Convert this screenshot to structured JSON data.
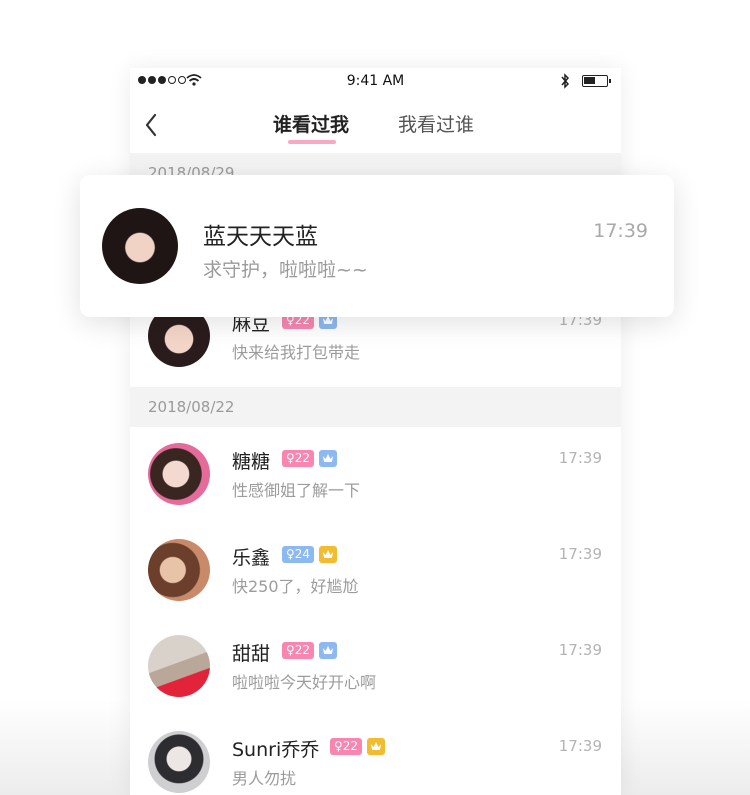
{
  "status_bar": {
    "time": "9:41 AM"
  },
  "nav": {
    "tabs": [
      {
        "label": "谁看过我",
        "active": true
      },
      {
        "label": "我看过谁",
        "active": false
      }
    ]
  },
  "sections": [
    {
      "date": "2018/08/29"
    },
    {
      "date": "2018/08/22"
    }
  ],
  "popup": {
    "name": "蓝天天天蓝",
    "message": "求守护，啦啦啦~~",
    "time": "17:39"
  },
  "rows": [
    {
      "name": "麻豆",
      "age": "♀22",
      "vip": "blue",
      "message": "快来给我打包带走",
      "time": "17:39"
    },
    {
      "name": "糖糖",
      "age": "♀22",
      "vip": "blue",
      "message": "性感御姐了解一下",
      "time": "17:39"
    },
    {
      "name": "乐鑫",
      "age": "♀24",
      "vip": "gold",
      "message": "快250了，好尴尬",
      "time": "17:39"
    },
    {
      "name": "甜甜",
      "age": "♀22",
      "vip": "blue",
      "message": "啦啦啦今天好开心啊",
      "time": "17:39"
    },
    {
      "name": "Sunri乔乔",
      "age": "♀22",
      "vip": "gold",
      "message": "男人勿扰",
      "time": "17:39"
    }
  ],
  "colors": {
    "tab_underline": "#f7a8c2",
    "age_badge_pink": "#f986b1",
    "age_badge_blue": "#8db9f3",
    "vip_blue": "#8db9f3",
    "vip_gold": "#f3bb2f"
  }
}
